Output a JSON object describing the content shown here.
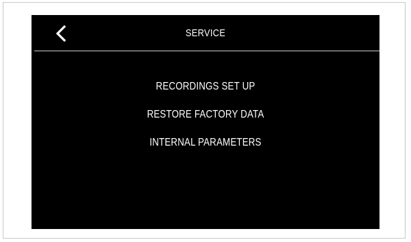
{
  "header": {
    "back_icon": "chevron-left-icon",
    "title": "SERVICE"
  },
  "menu": {
    "items": [
      {
        "label": "RECORDINGS SET UP"
      },
      {
        "label": "RESTORE FACTORY DATA"
      },
      {
        "label": "INTERNAL PARAMETERS"
      }
    ]
  },
  "colors": {
    "screen_background": "#000000",
    "text": "#ffffff",
    "divider": "#cfcfcf",
    "page_background": "#ffffff"
  }
}
